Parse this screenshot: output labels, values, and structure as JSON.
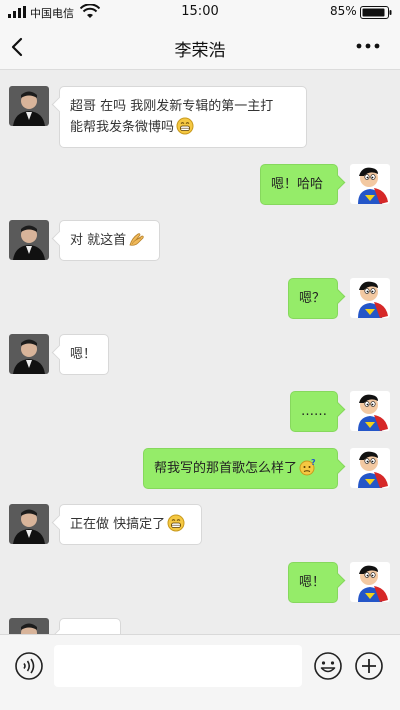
{
  "status": {
    "carrier": "中国电信",
    "time": "15:00",
    "battery_pct": "85%"
  },
  "nav": {
    "title": "李荣浩"
  },
  "messages": [
    {
      "side": "left",
      "text": "超哥 在吗 我刚发新专辑的第一主打\n能帮我发条微博吗",
      "emoji": "grin-icon"
    },
    {
      "side": "right",
      "text": "嗯！哈哈",
      "emoji": ""
    },
    {
      "side": "left",
      "text": "对 就这首",
      "emoji": "clap-icon"
    },
    {
      "side": "right",
      "text": "嗯？",
      "emoji": ""
    },
    {
      "side": "left",
      "text": "嗯！",
      "emoji": ""
    },
    {
      "side": "right",
      "text": "……",
      "emoji": ""
    },
    {
      "side": "right",
      "text": "帮我写的那首歌怎么样了",
      "emoji": "confused-icon"
    },
    {
      "side": "left",
      "text": "正在做 快搞定了",
      "emoji": "grin-icon"
    },
    {
      "side": "right",
      "text": "嗯！",
      "emoji": ""
    }
  ],
  "input": {
    "placeholder": ""
  },
  "colors": {
    "bubble_right": "#95ec69",
    "bubble_left": "#ffffff",
    "background": "#ededed"
  }
}
